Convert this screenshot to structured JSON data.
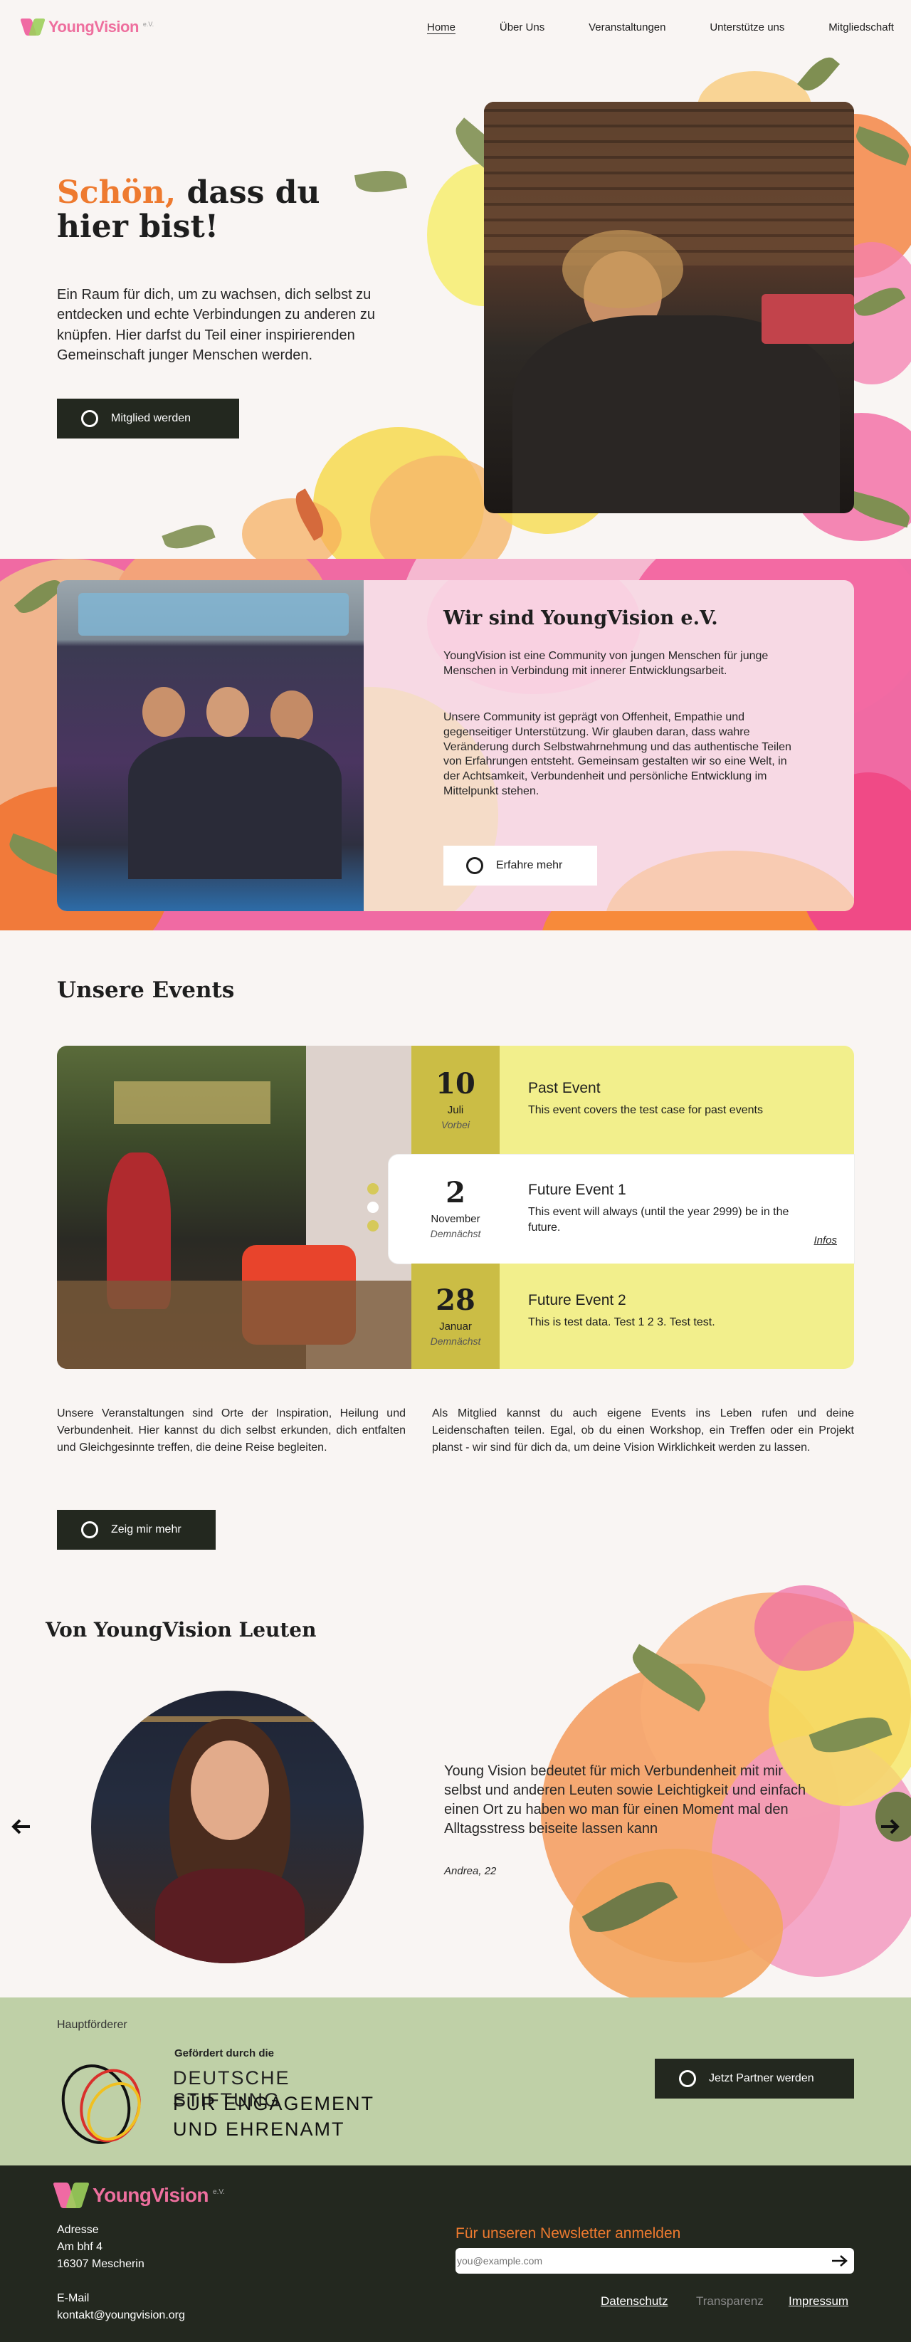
{
  "header": {
    "logo_text": "YoungVision",
    "logo_suffix": "e.V.",
    "nav": [
      {
        "label": "Home"
      },
      {
        "label": "Über Uns"
      },
      {
        "label": "Veranstaltungen"
      },
      {
        "label": "Unterstütze uns"
      },
      {
        "label": "Mitgliedschaft"
      }
    ]
  },
  "hero": {
    "title_accent": "Schön,",
    "title_rest": "dass du hier bist!",
    "text": "Ein Raum für dich, um zu wachsen, dich selbst zu entdecken und echte Verbindungen zu anderen zu knüpfen. Hier darfst du Teil einer inspirierenden Gemeinschaft junger Menschen werden.",
    "cta": "Mitglied werden"
  },
  "about": {
    "title": "Wir sind YoungVision e.V.",
    "p1": "YoungVision ist eine Community von jungen Menschen für junge Menschen in Verbindung mit innerer Entwicklungsarbeit.",
    "p2": "Unsere Community ist geprägt von Offenheit, Empathie und gegenseitiger Unterstützung. Wir glauben daran, dass wahre Veränderung durch Selbstwahrnehmung und das authentische Teilen von Erfahrungen entsteht. Gemeinsam gestalten wir so eine Welt, in der Achtsamkeit, Verbundenheit und persönliche Entwicklung im Mittelpunkt stehen.",
    "cta": "Erfahre mehr"
  },
  "events": {
    "title": "Unsere Events",
    "items": [
      {
        "day": "10",
        "month": "Juli",
        "status": "Vorbei",
        "title": "Past Event",
        "desc": "This event covers the test case for past events"
      },
      {
        "day": "2",
        "month": "November",
        "status": "Demnächst",
        "title": "Future Event 1",
        "desc": "This event will always (until the year 2999) be in the future.",
        "link": "Infos"
      },
      {
        "day": "28",
        "month": "Januar",
        "status": "Demnächst",
        "title": "Future Event 2",
        "desc": "This is test data. Test 1 2 3. Test test."
      }
    ],
    "col1": "Unsere Veranstaltungen sind Orte der Inspiration, Heilung und Verbundenheit. Hier kannst du dich selbst erkunden, dich entfalten und Gleichgesinnte treffen, die deine Reise begleiten.",
    "col2": "Als Mitglied kannst du auch eigene Events ins Leben rufen und deine Leidenschaften teilen. Egal, ob du einen Workshop, ein Treffen oder ein Projekt planst - wir sind für dich da, um deine Vision Wirklichkeit werden zu lassen.",
    "cta": "Zeig mir mehr"
  },
  "testimonials": {
    "title": "Von YoungVision Leuten",
    "quote": "Young Vision bedeutet für mich Verbundenheit mit mir selbst und anderen Leuten sowie Leichtigkeit und einfach einen Ort zu haben wo man für einen Moment mal den Alltagsstress beiseite lassen kann",
    "author": "Andrea, 22"
  },
  "sponsor": {
    "label": "Hauptförderer",
    "supported_by": "Gefördert durch die",
    "line1": "DEUTSCHE STIFTUNG",
    "line2": "FÜR ENGAGEMENT",
    "line3": "UND EHRENAMT",
    "cta": "Jetzt Partner werden"
  },
  "footer": {
    "logo_text": "YoungVision",
    "logo_suffix": "e.V.",
    "address_label": "Adresse",
    "address_line1": "Am bhf 4",
    "address_line2": "16307 Mescherin",
    "email_label": "E-Mail",
    "email": "kontakt@youngvision.org",
    "newsletter_title": "Für unseren Newsletter anmelden",
    "newsletter_placeholder": "you@example.com",
    "links": [
      {
        "label": "Datenschutz"
      },
      {
        "label": "Transparenz"
      },
      {
        "label": "Impressum"
      }
    ]
  },
  "colors": {
    "accent_orange": "#ee7a2f",
    "dark": "#23281f",
    "pink": "#f06aa3",
    "yellow_event": "#f2ef8c",
    "sponsor_green": "#bfd0a7"
  }
}
